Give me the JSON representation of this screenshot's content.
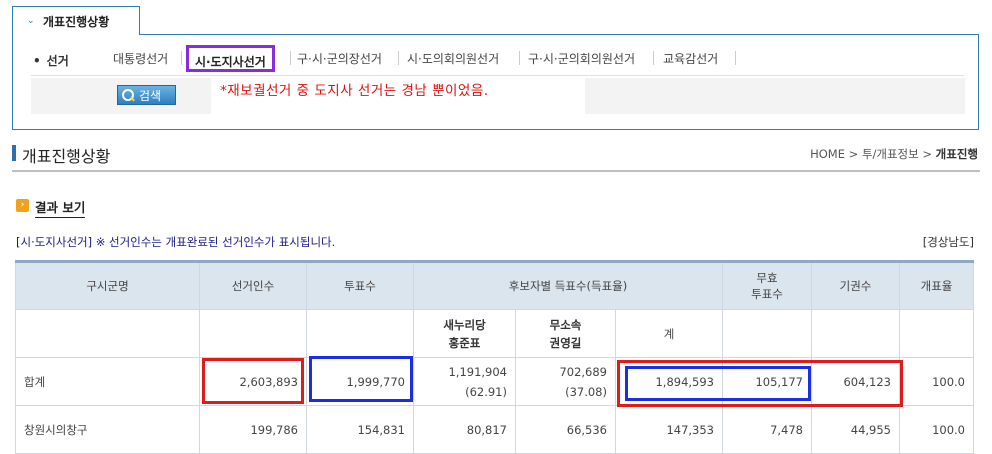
{
  "tab": {
    "label": "개표진행상황"
  },
  "election_filter": {
    "label": "선거",
    "tabs": [
      {
        "label": "대통령선거",
        "active": false
      },
      {
        "label": "시·도지사선거",
        "active": true
      },
      {
        "label": "구·시·군의장선거",
        "active": false
      },
      {
        "label": "시·도의회의원선거",
        "active": false
      },
      {
        "label": "구·시·군의회의원선거",
        "active": false
      },
      {
        "label": "교육감선거",
        "active": false
      }
    ],
    "search_button": "검색",
    "note": "*재보궐선거 중 도지사 선거는 경남 뿐이었음."
  },
  "page": {
    "title": "개표진행상황",
    "breadcrumb": {
      "home": "HOME",
      "sep": ">",
      "mid": "투/개표정보",
      "current": "개표진행"
    }
  },
  "result": {
    "heading": "결과 보기",
    "info": "[시·도지사선거] ※ 선거인수는 개표완료된 선거인수가 표시됩니다.",
    "region": "[경상남도]"
  },
  "table": {
    "headers": {
      "district": "구시군명",
      "electors": "선거인수",
      "voters": "투표수",
      "candidates_group": "후보자별 득표수(득표율)",
      "invalid_1": "무효",
      "invalid_2": "투표수",
      "abstain": "기권수",
      "rate": "개표율"
    },
    "candidates": [
      {
        "party": "새누리당",
        "name": "홍준표"
      },
      {
        "party": "무소속",
        "name": "권영길"
      }
    ],
    "total_label": "계",
    "rows": [
      {
        "district": "합계",
        "electors": "2,603,893",
        "voters": "1,999,770",
        "cand1_votes": "1,191,904",
        "cand1_pct": "(62.91)",
        "cand2_votes": "702,689",
        "cand2_pct": "(37.08)",
        "total": "1,894,593",
        "invalid": "105,177",
        "abstain": "604,123",
        "rate": "100.0"
      },
      {
        "district": "창원시의창구",
        "electors": "199,786",
        "voters": "154,831",
        "cand1_votes": "80,817",
        "cand1_pct": "",
        "cand2_votes": "66,536",
        "cand2_pct": "",
        "total": "147,353",
        "invalid": "7,478",
        "abstain": "44,955",
        "rate": "100.0"
      }
    ]
  },
  "highlight_colors": {
    "red": "#e01b1b",
    "blue": "#1a2ee6",
    "purple": "#8a2be2"
  }
}
